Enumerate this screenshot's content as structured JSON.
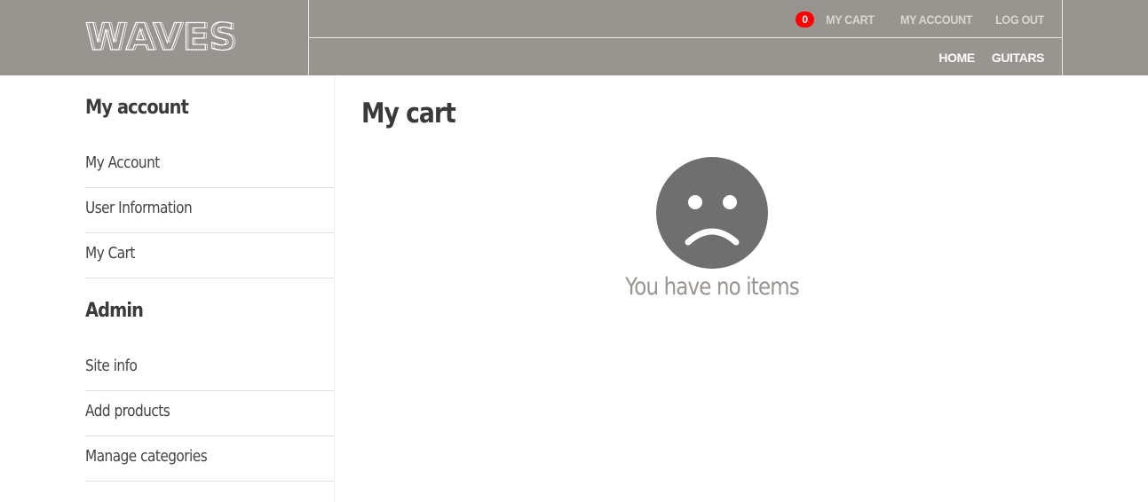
{
  "header": {
    "logo_text": "WAVES",
    "cart_count": "0",
    "top_links": {
      "cart": "MY CART",
      "account": "MY ACCOUNT",
      "logout": "LOG OUT"
    },
    "bottom_links": {
      "home": "HOME",
      "guitars": "GUITARS"
    }
  },
  "sidebar": {
    "account_heading": "My account",
    "account_items": [
      {
        "label": "My Account"
      },
      {
        "label": "User Information"
      },
      {
        "label": "My Cart"
      }
    ],
    "admin_heading": "Admin",
    "admin_items": [
      {
        "label": "Site info"
      },
      {
        "label": "Add products"
      },
      {
        "label": "Manage categories"
      }
    ]
  },
  "main": {
    "title": "My cart",
    "empty_message": "You have no items",
    "empty_icon": "sad-face-icon"
  },
  "colors": {
    "header_bg": "#98948f",
    "badge": "#ff0000",
    "face": "#6f6f6f",
    "heading": "#3a3a3a",
    "muted_text": "#9a9590"
  }
}
